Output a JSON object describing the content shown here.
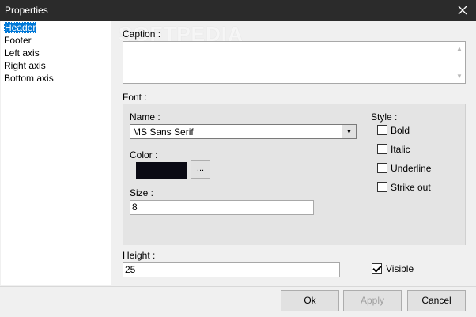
{
  "window": {
    "title": "Properties"
  },
  "tree": {
    "items": [
      {
        "label": "Header",
        "selected": true
      },
      {
        "label": "Footer"
      },
      {
        "label": "Left axis"
      },
      {
        "label": "Right axis"
      },
      {
        "label": "Bottom axis"
      }
    ]
  },
  "watermark": "SOFTPEDIA",
  "caption": {
    "label": "Caption :",
    "value": ""
  },
  "font": {
    "group_label": "Font :",
    "name_label": "Name :",
    "name_value": "MS Sans Serif",
    "color_label": "Color :",
    "color_value": "#0a0a14",
    "color_button": "...",
    "size_label": "Size :",
    "size_value": "8",
    "style_label": "Style :",
    "styles": [
      {
        "label": "Bold",
        "checked": false
      },
      {
        "label": "Italic",
        "checked": false
      },
      {
        "label": "Underline",
        "checked": false
      },
      {
        "label": "Strike out",
        "checked": false
      }
    ]
  },
  "height": {
    "label": "Height :",
    "value": "25"
  },
  "visible": {
    "label": "Visible",
    "checked": true
  },
  "buttons": {
    "ok": "Ok",
    "apply": "Apply",
    "cancel": "Cancel"
  }
}
